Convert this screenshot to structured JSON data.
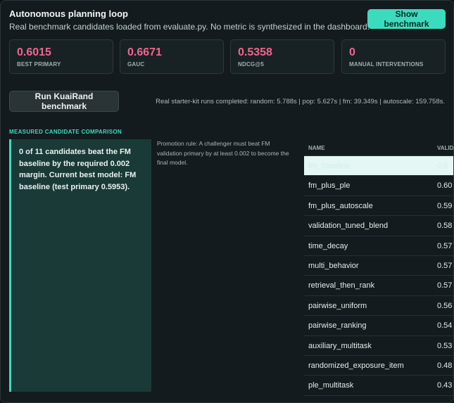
{
  "header": {
    "title": "Autonomous planning loop",
    "subtitle": "Real benchmark candidates loaded from evaluate.py. No metric is synthesized in the dashboard.",
    "show_button": "Show benchmark"
  },
  "metrics": [
    {
      "value": "0.6015",
      "label": "BEST PRIMARY"
    },
    {
      "value": "0.6671",
      "label": "GAUC"
    },
    {
      "value": "0.5358",
      "label": "NDCG@5"
    },
    {
      "value": "0",
      "label": "MANUAL INTERVENTIONS"
    }
  ],
  "actions": {
    "run_button": "Run KuaiRand benchmark",
    "runs_completed": "Real starter-kit runs completed: random: 5.788s | pop: 5.627s | fm: 39.349s | autoscale: 159.758s."
  },
  "comparison": {
    "section_label": "MEASURED CANDIDATE COMPARISON",
    "summary": "0 of 11 candidates beat the FM baseline by the required 0.002 margin. Current best model: FM baseline (test primary 0.5953).",
    "rule": "Promotion rule: A challenger must beat FM validation primary by at least 0.002 to become the final model."
  },
  "table": {
    "columns": [
      "NAME",
      "VALID"
    ],
    "rows": [
      {
        "name": "fm_baseline",
        "value": "0.6"
      },
      {
        "name": "fm_plus_ple",
        "value": "0.60"
      },
      {
        "name": "fm_plus_autoscale",
        "value": "0.59"
      },
      {
        "name": "validation_tuned_blend",
        "value": "0.58"
      },
      {
        "name": "time_decay",
        "value": "0.57"
      },
      {
        "name": "multi_behavior",
        "value": "0.57"
      },
      {
        "name": "retrieval_then_rank",
        "value": "0.57"
      },
      {
        "name": "pairwise_uniform",
        "value": "0.56"
      },
      {
        "name": "pairwise_ranking",
        "value": "0.54"
      },
      {
        "name": "auxiliary_multitask",
        "value": "0.53"
      },
      {
        "name": "randomized_exposure_item",
        "value": "0.48"
      },
      {
        "name": "ple_multitask",
        "value": "0.43"
      }
    ]
  },
  "colors": {
    "accent": "#3ddbbd",
    "metric_value": "#f0668f",
    "summary_bg": "#1a3a37",
    "highlight_row": "#e4f7f2"
  }
}
